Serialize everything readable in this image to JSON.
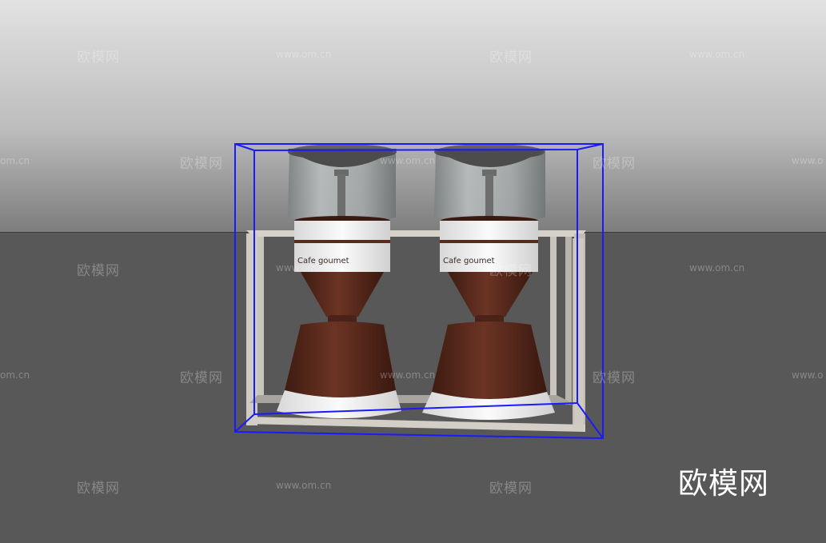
{
  "scene": {
    "label_text": "Cafe goumet",
    "colors": {
      "sky_top": "#dcdcdc",
      "sky_bottom": "#858585",
      "ground": "#585858",
      "selection_box": "#1a1aff",
      "frame": "#c9c5bd",
      "coffee_brown": "#5a2a1c",
      "base_white": "#f2f2f2",
      "hopper_glass": "#a9acad",
      "hopper_lid": "#555555"
    },
    "objects": [
      "coffee-grinder-left",
      "coffee-grinder-right"
    ]
  },
  "watermark": {
    "cn": "欧模网",
    "url": "www.om.cn",
    "url_partial": "om.cn",
    "cn_partial": "欧模",
    "url_partial_start": "www.o"
  },
  "brand": {
    "logo": "欧模网"
  }
}
